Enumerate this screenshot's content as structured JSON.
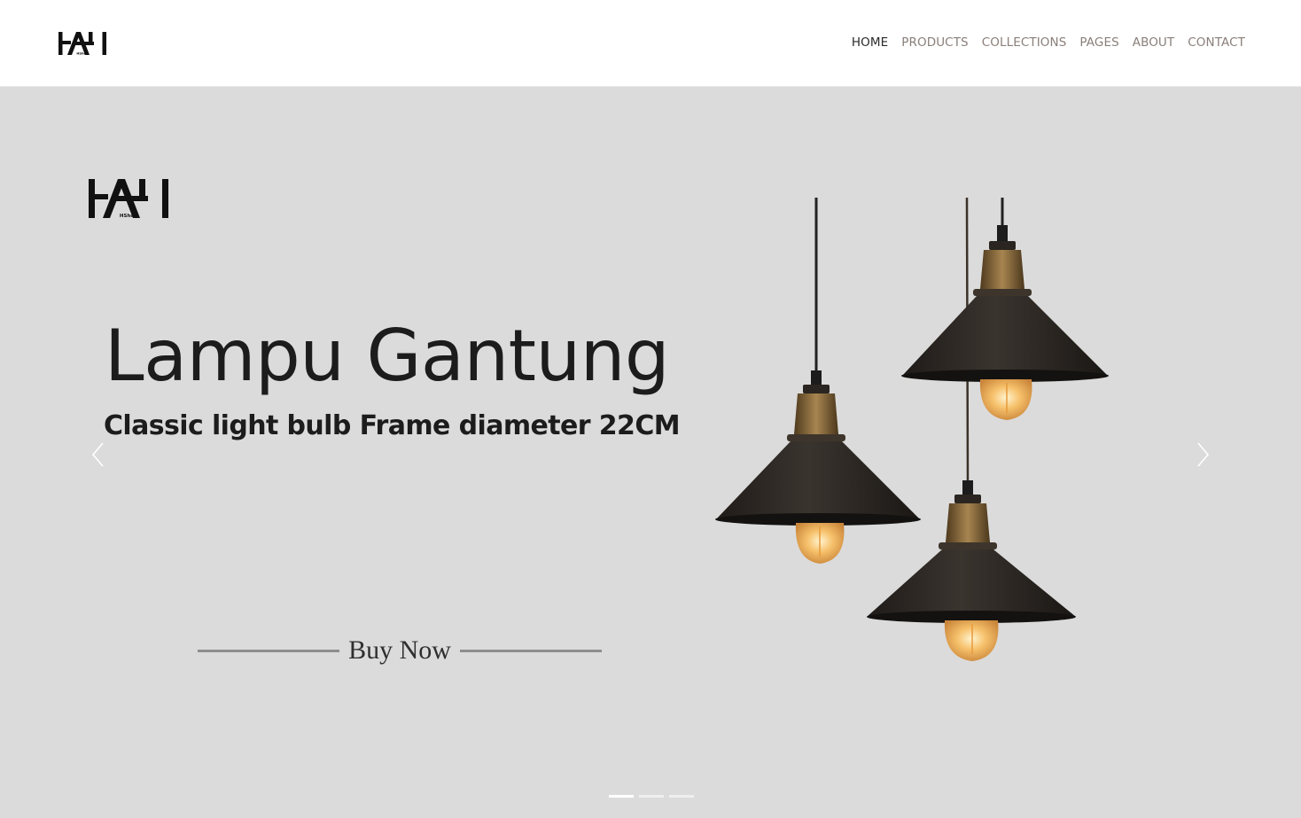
{
  "header": {
    "logo_text": "HShop",
    "nav": [
      {
        "label": "HOME",
        "active": true
      },
      {
        "label": "PRODUCTS",
        "active": false
      },
      {
        "label": "COLLECTIONS",
        "active": false
      },
      {
        "label": "PAGES",
        "active": false
      },
      {
        "label": "ABOUT",
        "active": false
      },
      {
        "label": "CONTACT",
        "active": false
      }
    ]
  },
  "slide": {
    "logo_text": "HShop",
    "title": "Lampu Gantung",
    "subtitle": "Classic light bulb Frame diameter 22CM",
    "cta": "Buy Now",
    "image": "three-black-pendant-lamps",
    "prev_icon": "chevron-left-icon",
    "next_icon": "chevron-right-icon"
  },
  "carousel": {
    "slide_count": 3,
    "active_index": 0
  },
  "colors": {
    "hero_background": "#dbdbdb",
    "nav_text": "#8a7f7a",
    "nav_active": "#2a2a2a",
    "title_text": "#1c1c1c",
    "lamp_shade": "#2b2622",
    "bulb_glow": "#f3b45c",
    "brass": "#8a6b3a"
  }
}
